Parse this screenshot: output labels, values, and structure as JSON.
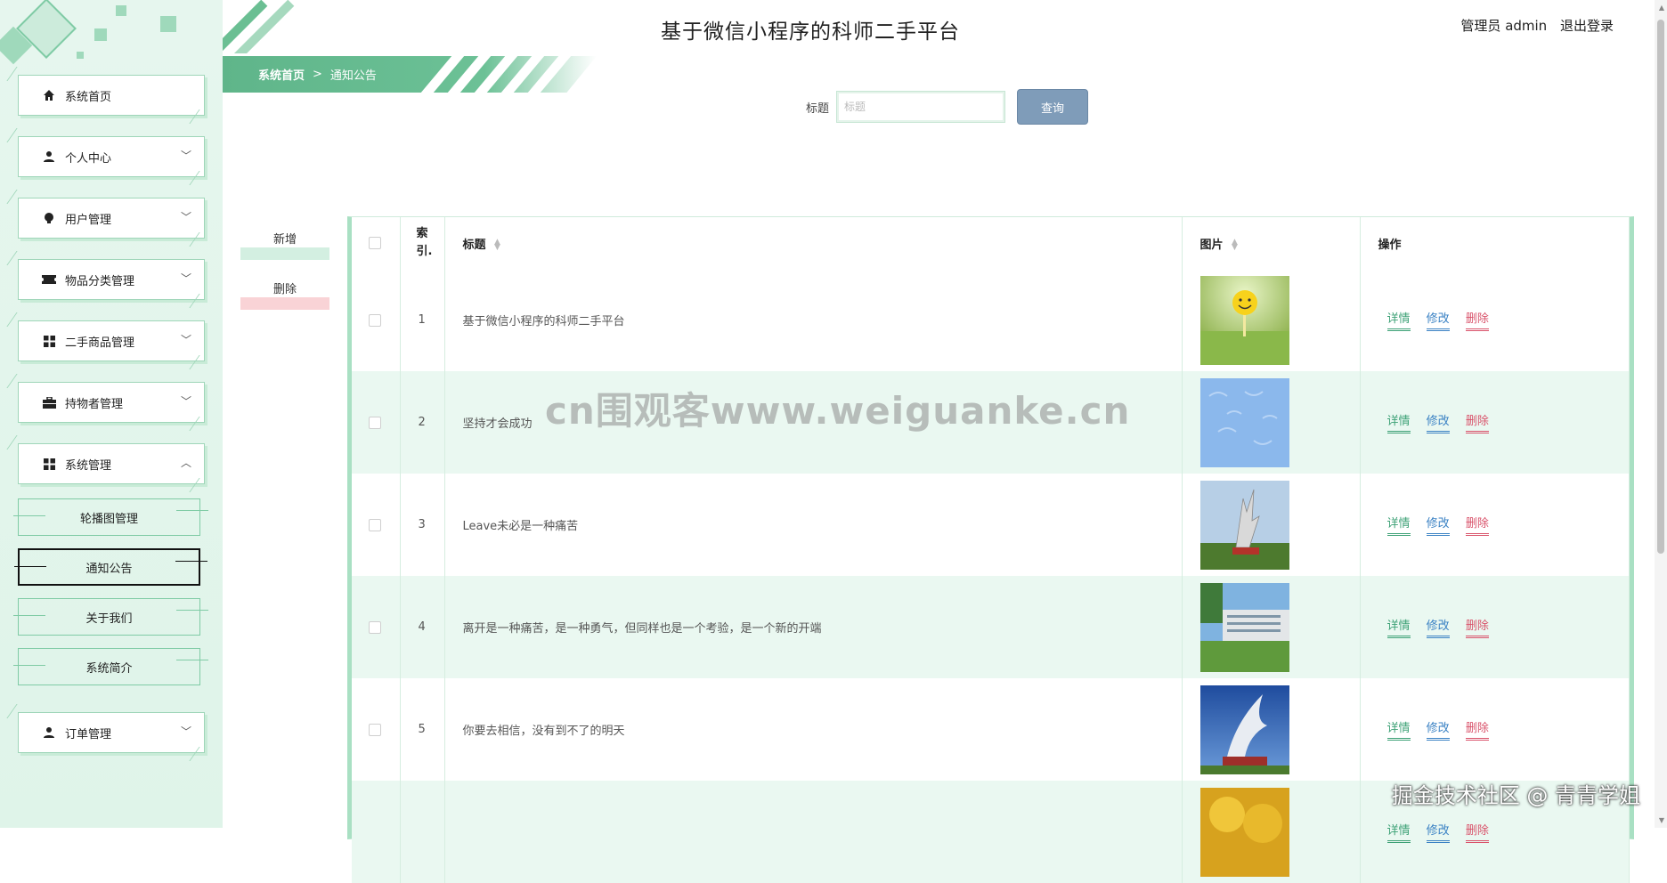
{
  "app": {
    "title": "基于微信小程序的科师二手平台"
  },
  "user": {
    "role_label": "管理员 admin",
    "logout_label": "退出登录"
  },
  "breadcrumb": {
    "home": "系统首页",
    "sep": ">",
    "current": "通知公告"
  },
  "sidebar": {
    "items": [
      {
        "label": "系统首页",
        "icon": "home-icon",
        "expandable": false
      },
      {
        "label": "个人中心",
        "icon": "user-icon",
        "expandable": true
      },
      {
        "label": "用户管理",
        "icon": "bulb-icon",
        "expandable": true
      },
      {
        "label": "物品分类管理",
        "icon": "ticket-icon",
        "expandable": true
      },
      {
        "label": "二手商品管理",
        "icon": "grid-icon",
        "expandable": true
      },
      {
        "label": "持物者管理",
        "icon": "briefcase-icon",
        "expandable": true
      },
      {
        "label": "系统管理",
        "icon": "grid-icon",
        "expandable": true,
        "expanded": true
      },
      {
        "label": "订单管理",
        "icon": "user-icon",
        "expandable": true
      }
    ],
    "sub_items": [
      {
        "label": "轮播图管理"
      },
      {
        "label": "通知公告",
        "active": true
      },
      {
        "label": "关于我们"
      },
      {
        "label": "系统简介"
      }
    ],
    "caret_down": "﹀",
    "caret_up": "︿"
  },
  "search": {
    "label": "标题",
    "placeholder": "标题",
    "value": "",
    "button": "查询"
  },
  "actions": {
    "add": "新增",
    "delete": "删除",
    "add_color": "#d3efe1",
    "delete_color": "#f9d3d6"
  },
  "table": {
    "headers": {
      "index": "索引.",
      "title": "标题",
      "image": "图片",
      "ops": "操作"
    },
    "ops": {
      "detail": "详情",
      "edit": "修改",
      "delete": "删除"
    },
    "rows": [
      {
        "index": "1",
        "title": "基于微信小程序的科师二手平台",
        "image": "smiley-golf-ball"
      },
      {
        "index": "2",
        "title": "坚持才会成功",
        "image": "blue-pattern"
      },
      {
        "index": "3",
        "title": "Leave未必是一种痛苦",
        "image": "campus-sculpture"
      },
      {
        "index": "4",
        "title": "离开是一种痛苦，是一种勇气，但同样也是一个考验，是一个新的开端",
        "image": "campus-building"
      },
      {
        "index": "5",
        "title": "你要去相信，没有到不了的明天",
        "image": "white-sculpture-sky"
      },
      {
        "index": "",
        "title": "",
        "image": "yellow-tree"
      }
    ]
  },
  "watermarks": {
    "center": "cn围观客www.weiguanke.cn",
    "corner": "掘金技术社区 @ 青青学姐"
  },
  "colors": {
    "accent": "#6cc196",
    "search_button": "#7f9cb9",
    "detail": "#3da176",
    "edit": "#3b82c4",
    "delete": "#d9536b"
  }
}
